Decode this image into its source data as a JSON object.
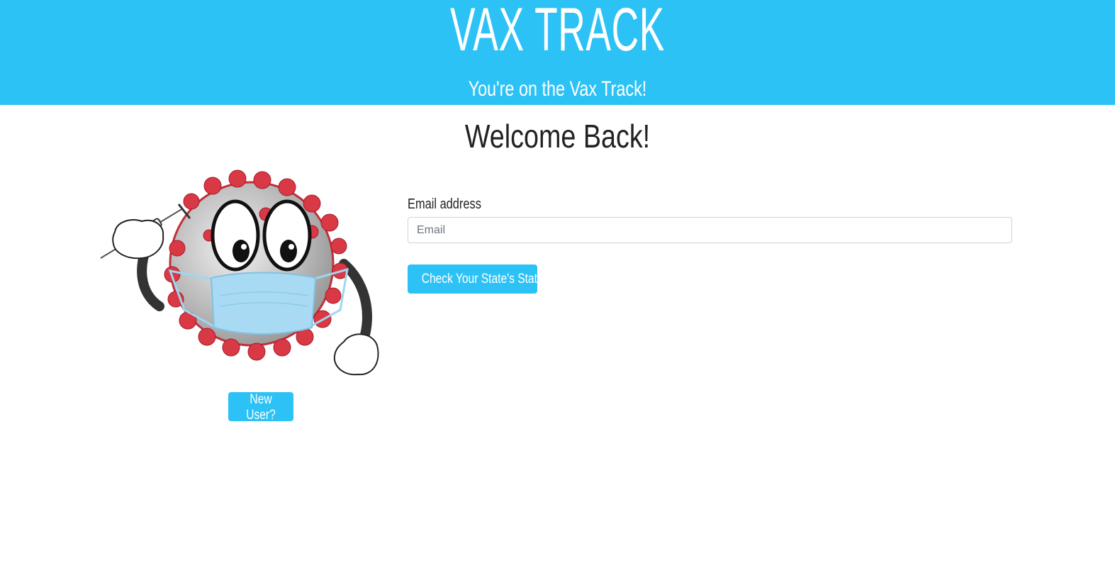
{
  "header": {
    "brand": "VAX TRACK",
    "tagline": "You're on the Vax Track!",
    "background_color": "#2dc2f5"
  },
  "main": {
    "heading": "Welcome Back!",
    "mascot_icon": "masked-virus-mascot-holding-syringe",
    "new_user_button": "New User?",
    "email_label": "Email address",
    "email_placeholder": "Email",
    "email_value": "",
    "submit_button": "Check Your State's Status",
    "accent_color": "#2dc2f5"
  }
}
